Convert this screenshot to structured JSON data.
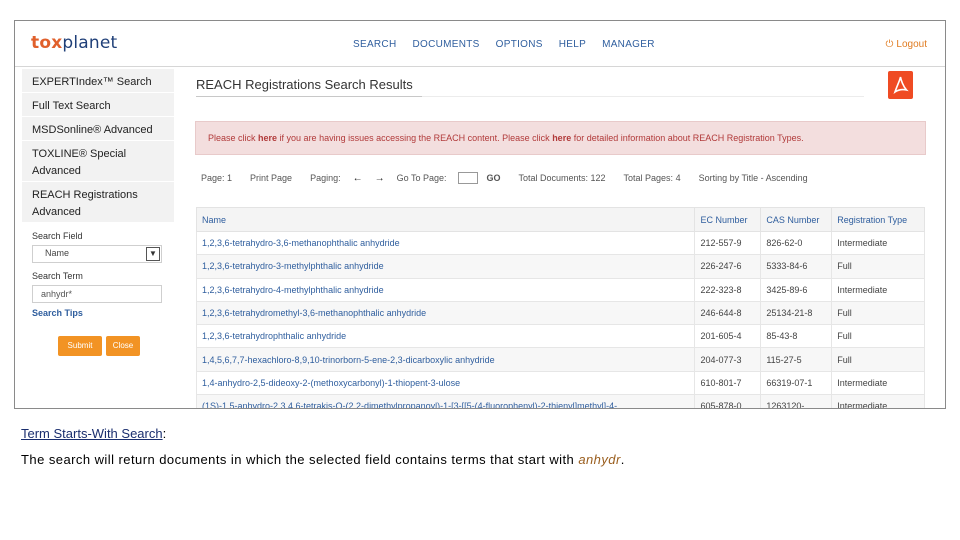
{
  "header": {
    "logo_part1": "tox",
    "logo_part2": "planet",
    "nav": [
      "SEARCH",
      "DOCUMENTS",
      "OPTIONS",
      "HELP",
      "MANAGER"
    ],
    "logout_label": "Logout"
  },
  "sidebar": {
    "items": [
      {
        "label": "EXPERTIndex™ Search"
      },
      {
        "label": "Full Text Search"
      },
      {
        "label": "MSDSonline® Advanced"
      },
      {
        "label": "TOXLINE® Special Advanced"
      },
      {
        "label": "REACH Registrations Advanced"
      }
    ],
    "search_field_label": "Search Field",
    "search_field_value": "Name",
    "search_term_label": "Search Term",
    "search_term_value": "anhydr*",
    "search_tips_label": "Search Tips",
    "submit_label": "Submit",
    "close_label": "Close"
  },
  "main": {
    "title": "REACH Registrations Search Results",
    "notice": {
      "p1": "Please click ",
      "here1": "here",
      "p2": " if you are having issues accessing the REACH content. Please click ",
      "here2": "here",
      "p3": " for detailed information about REACH Registration Types."
    },
    "paging": {
      "page": "Page: 1",
      "print": "Print Page",
      "paging": "Paging:",
      "prev_arrow": "←",
      "next_arrow": "→",
      "goto": "Go To Page:",
      "go": "GO",
      "total_docs": "Total Documents: 122",
      "total_pages": "Total Pages: 4",
      "sorting": "Sorting by Title - Ascending"
    },
    "table": {
      "columns": [
        "Name",
        "EC Number",
        "CAS Number",
        "Registration Type"
      ],
      "rows": [
        {
          "name": "1,2,3,6-tetrahydro-3,6-methanophthalic anhydride",
          "ec": "212-557-9",
          "cas": "826-62-0",
          "type": "Intermediate"
        },
        {
          "name": "1,2,3,6-tetrahydro-3-methylphthalic anhydride",
          "ec": "226-247-6",
          "cas": "5333-84-6",
          "type": "Full"
        },
        {
          "name": "1,2,3,6-tetrahydro-4-methylphthalic anhydride",
          "ec": "222-323-8",
          "cas": "3425-89-6",
          "type": "Intermediate"
        },
        {
          "name": "1,2,3,6-tetrahydromethyl-3,6-methanophthalic anhydride",
          "ec": "246-644-8",
          "cas": "25134-21-8",
          "type": "Full"
        },
        {
          "name": "1,2,3,6-tetrahydrophthalic anhydride",
          "ec": "201-605-4",
          "cas": "85-43-8",
          "type": "Full"
        },
        {
          "name": "1,4,5,6,7,7-hexachloro-8,9,10-trinorborn-5-ene-2,3-dicarboxylic anhydride",
          "ec": "204-077-3",
          "cas": "115-27-5",
          "type": "Full"
        },
        {
          "name": "1,4-anhydro-2,5-dideoxy-2-(methoxycarbonyl)-1-thiopent-3-ulose",
          "ec": "610-801-7",
          "cas": "66319-07-1",
          "type": "Intermediate"
        },
        {
          "name": "(1S)-1,5-anhydro-2,3,4,6-tetrakis-O-(2,2-dimethylpropanoyl)-1-[3-[[5-(4-fluorophenyl)-2-thienyl]methyl]-4-",
          "ec": "605-878-0",
          "cas": "1263120-",
          "type": "Intermediate"
        }
      ]
    }
  },
  "caption": {
    "title": "Term Starts-With Search",
    "colon": ":",
    "body_text": "The search will return documents in which the selected field contains terms that start with ",
    "term": "anhydr",
    "period": "."
  },
  "colors": {
    "logo_orange": "#e0602c",
    "logo_navy": "#1f3f78",
    "link_blue": "#2f5e9e",
    "button_orange": "#f29324",
    "notice_bg": "#f3dede",
    "notice_text": "#b13a3a",
    "pdf_red": "#ef4b23"
  },
  "icons": [
    "power-icon",
    "pdf-icon",
    "chevron-down-icon",
    "arrow-left-icon",
    "arrow-right-icon"
  ]
}
